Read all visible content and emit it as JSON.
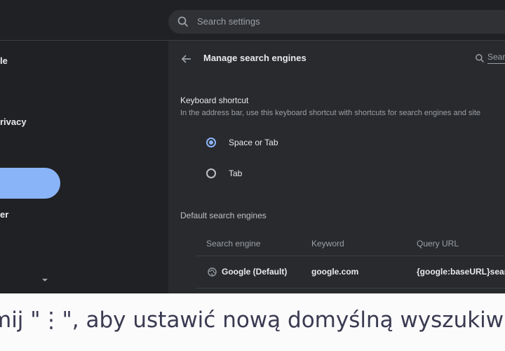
{
  "header": {
    "search_placeholder": "Search settings"
  },
  "sidebar": {
    "items": [
      {
        "label": "le"
      },
      {
        "label": "rivacy"
      },
      {
        "label": "er"
      }
    ],
    "active_color": "#8ab4f8"
  },
  "main": {
    "title": "Manage search engines",
    "mini_search": "Searc",
    "shortcut": {
      "label": "Keyboard shortcut",
      "description": "In the address bar, use this keyboard shortcut with shortcuts for search engines and site",
      "options": [
        {
          "label": "Space or Tab",
          "selected": true
        },
        {
          "label": "Tab",
          "selected": false
        }
      ]
    },
    "defaults": {
      "label": "Default search engines",
      "columns": [
        "Search engine",
        "Keyword",
        "Query URL"
      ],
      "rows": [
        {
          "engine": "Google (Default)",
          "keyword": "google.com",
          "url": "{google:baseURL}search"
        }
      ]
    }
  },
  "caption": {
    "text": "mij \"⋮\", aby ustawić nową domyślną wyszukiw"
  },
  "colors": {
    "background": "#202124",
    "panel": "#292a2d",
    "accent": "#8ab4f8",
    "text": "#e8eaed",
    "muted": "#9aa0a6"
  }
}
